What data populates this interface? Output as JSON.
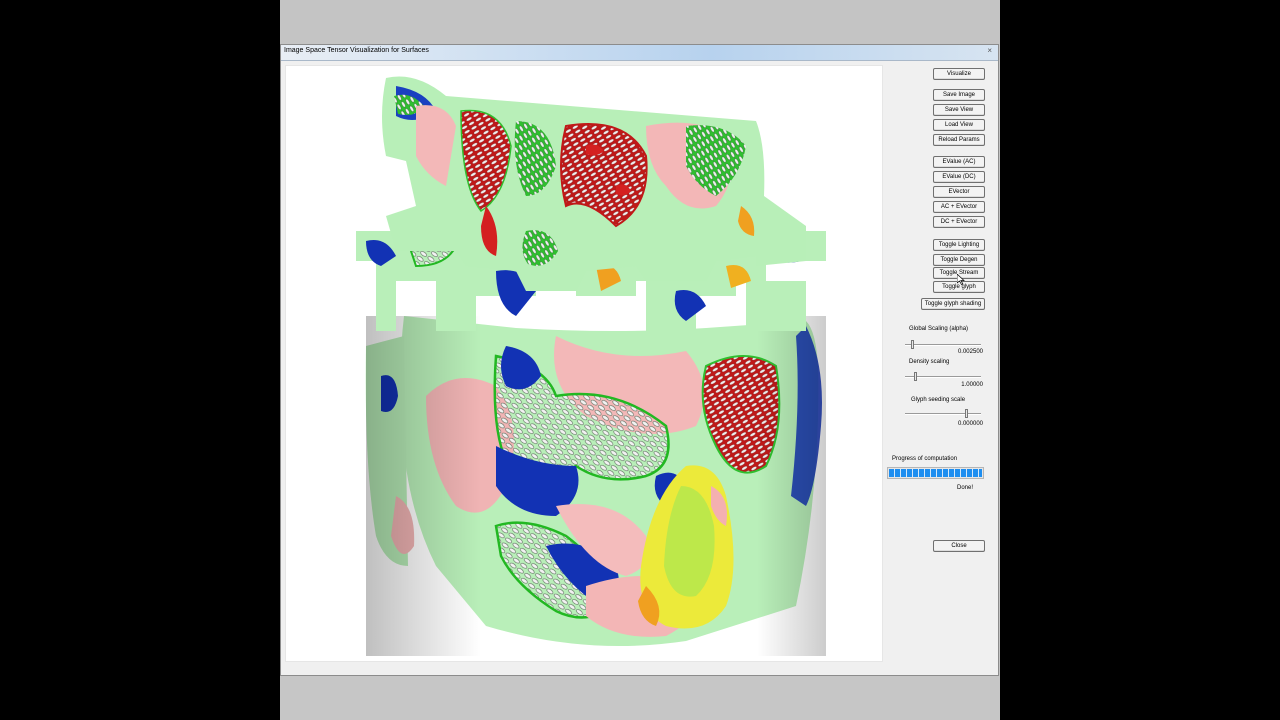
{
  "window": {
    "title": "Image Space Tensor Visualization for Surfaces",
    "close_glyph": "×"
  },
  "buttons": {
    "visualize": "Visualize",
    "save_image": "Save Image",
    "save_view": "Save View",
    "load_view": "Load View",
    "reload_params": "Reload Params",
    "evalue_ac": "EValue (AC)",
    "evalue_dc": "EValue (DC)",
    "evector": "EVector",
    "ac_evector": "AC + EVector",
    "dc_evector": "DC + EVector",
    "toggle_lighting": "Toggle Lighting",
    "toggle_degen": "Toggle Degen",
    "toggle_stream": "Toggle Stream",
    "toggle_glyph": "Toggle glyph",
    "toggle_glyph_shading": "Toggle glyph shading",
    "close": "Close"
  },
  "sliders": {
    "global_scaling": {
      "label": "Global Scaling (alpha)",
      "value": "0.002500",
      "fraction": 0.08
    },
    "density_scaling": {
      "label": "Density scaling",
      "value": "1.00000",
      "fraction": 0.12
    },
    "glyph_seeding": {
      "label": "Glyph seeding scale",
      "value": "0.000000",
      "fraction": 0.82
    }
  },
  "progress": {
    "label": "Progress of computation",
    "fraction": 1.0,
    "status": "Done!"
  },
  "colors": {
    "surface_green": "#b8f0b8",
    "region_pink": "#f4b8b8",
    "region_red": "#d42020",
    "region_blue": "#1030b8",
    "region_yellow": "#e8e030",
    "glyph_outline": "#22b822"
  }
}
